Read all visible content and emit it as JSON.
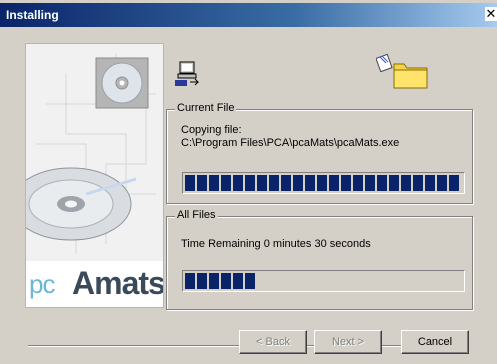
{
  "window": {
    "title": "Installing",
    "close_glyph": "✕"
  },
  "banner": {
    "logo_part1": "pc",
    "logo_part2": "Amats"
  },
  "icons": {
    "left": "computer-transfer-icon",
    "right": "folder-icon"
  },
  "current_file": {
    "legend": "Current File",
    "line1": "Copying file:",
    "line2": "C:\\Program Files\\PCA\\pcaMats\\pcaMats.exe",
    "progress": 1.0
  },
  "all_files": {
    "legend": "All Files",
    "status": "Time Remaining 0 minutes 30 seconds",
    "progress": 0.25
  },
  "buttons": {
    "back": "< Back",
    "next": "Next >",
    "cancel": "Cancel"
  },
  "colors": {
    "progress_fill": "#0a246a",
    "dialog_face": "#d4d0c8"
  }
}
